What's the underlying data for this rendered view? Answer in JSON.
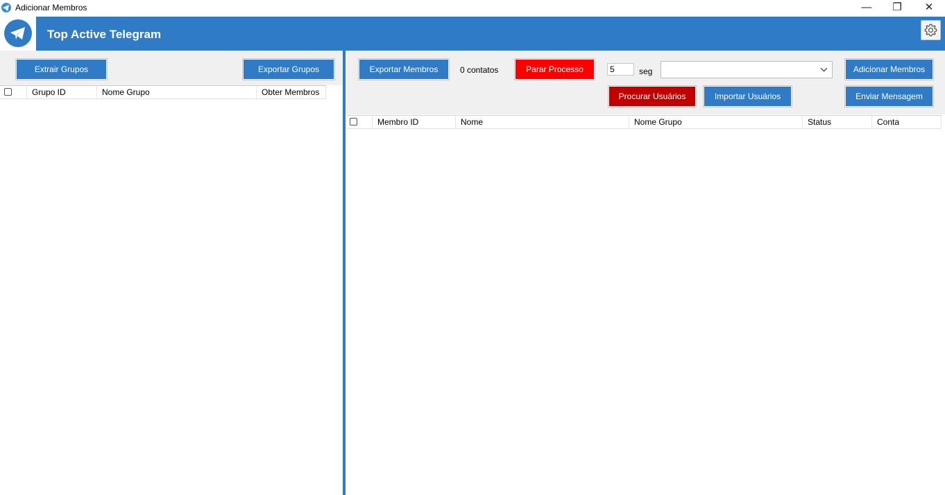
{
  "window": {
    "title": "Adicionar Membros",
    "controls": {
      "minimize": "—",
      "maximize": "❐",
      "close": "✕"
    }
  },
  "header": {
    "app_title": "Top Active Telegram",
    "logo_icon": "telegram-icon",
    "settings_icon": "gear-icon",
    "color": "#2f7bc5"
  },
  "left": {
    "extract_button": "Extrair Grupos",
    "export_button": "Exportar Grupos",
    "columns": [
      "Grupo ID",
      "Nome Grupo",
      "Obter Membros"
    ]
  },
  "right": {
    "export_button": "Exportar Membros",
    "contacts_label": "0 contatos",
    "stop_button": "Parar Processo",
    "interval_value": "5",
    "interval_unit": "seg",
    "combo_value": "",
    "add_members_button": "Adicionar Membros",
    "search_users_button": "Procurar Usuários",
    "import_users_button": "Importar Usuários",
    "send_message_button": "Enviar Mensagem",
    "columns": [
      "Membro ID",
      "Nome",
      "Nome Grupo",
      "Status",
      "Conta"
    ]
  },
  "colors": {
    "primary": "#2f7bc5",
    "stop": "#ff0000",
    "search": "#c00000",
    "toolbar_bg": "#f0f0f0"
  }
}
